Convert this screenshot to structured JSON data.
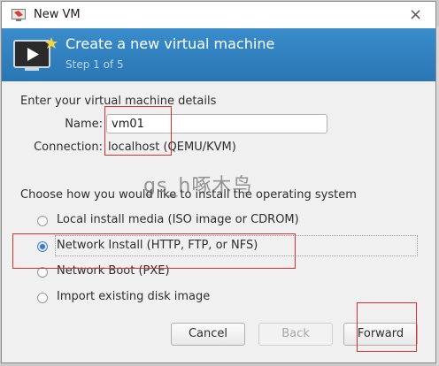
{
  "window": {
    "title": "New VM",
    "close_glyph": "×"
  },
  "header": {
    "title": "Create a new virtual machine",
    "subtitle": "Step 1 of 5",
    "icon": "monitor-play-icon",
    "accent_color": "#2f7fbf"
  },
  "details": {
    "section_label": "Enter your virtual machine details",
    "name_label": "Name:",
    "name_value": "vm01",
    "connection_label": "Connection:",
    "connection_value": "localhost (QEMU/KVM)"
  },
  "install": {
    "section_label": "Choose how you would like to install the operating system",
    "options": [
      {
        "label": "Local install media (ISO image or CDROM)",
        "selected": false
      },
      {
        "label": "Network Install (HTTP, FTP, or NFS)",
        "selected": true
      },
      {
        "label": "Network Boot (PXE)",
        "selected": false
      },
      {
        "label": "Import existing disk image",
        "selected": false
      }
    ]
  },
  "buttons": {
    "cancel": "Cancel",
    "back": "Back",
    "forward": "Forward"
  },
  "watermark": "gs_h啄木鸟",
  "annotation_color": "#e0302a"
}
